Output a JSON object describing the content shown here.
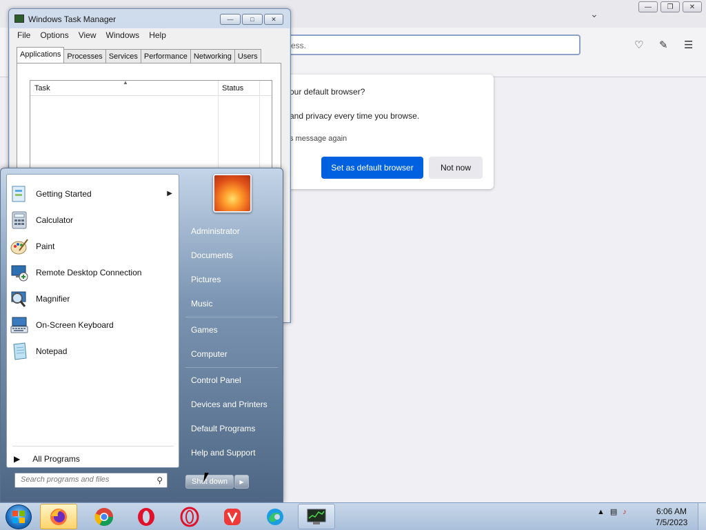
{
  "browser": {
    "url_placeholder": "ess.",
    "default_card": {
      "question": "our default browser?",
      "subtext": "and privacy every time you browse.",
      "checkbox_label": "s message again",
      "primary_button": "Set as default browser",
      "secondary_button": "Not now"
    },
    "accent": "#0061e0"
  },
  "task_manager": {
    "title": "Windows Task Manager",
    "menu": [
      "File",
      "Options",
      "View",
      "Windows",
      "Help"
    ],
    "tabs": [
      "Applications",
      "Processes",
      "Services",
      "Performance",
      "Networking",
      "Users"
    ],
    "active_tab": "Applications",
    "columns": [
      "Task",
      "Status"
    ]
  },
  "start_menu": {
    "programs": [
      {
        "label": "Getting Started",
        "icon": "getting-started-icon",
        "has_submenu": true
      },
      {
        "label": "Calculator",
        "icon": "calculator-icon"
      },
      {
        "label": "Paint",
        "icon": "paint-icon"
      },
      {
        "label": "Remote Desktop Connection",
        "icon": "remote-desktop-icon"
      },
      {
        "label": "Magnifier",
        "icon": "magnifier-icon"
      },
      {
        "label": "On-Screen Keyboard",
        "icon": "keyboard-icon"
      },
      {
        "label": "Notepad",
        "icon": "notepad-icon"
      }
    ],
    "all_programs": "All Programs",
    "search_placeholder": "Search programs and files",
    "right_links": [
      "Administrator",
      "Documents",
      "Pictures",
      "Music",
      "Games",
      "Computer",
      "Control Panel",
      "Devices and Printers",
      "Default Programs",
      "Help and Support"
    ],
    "shutdown_label": "Shut down"
  },
  "taskbar": {
    "items": [
      "firefox-icon",
      "chrome-icon",
      "opera-icon",
      "opera-gx-icon",
      "vivaldi-icon",
      "edge-icon",
      "task-manager-icon"
    ],
    "clock_time": "6:06 AM",
    "clock_date": "7/5/2023"
  }
}
